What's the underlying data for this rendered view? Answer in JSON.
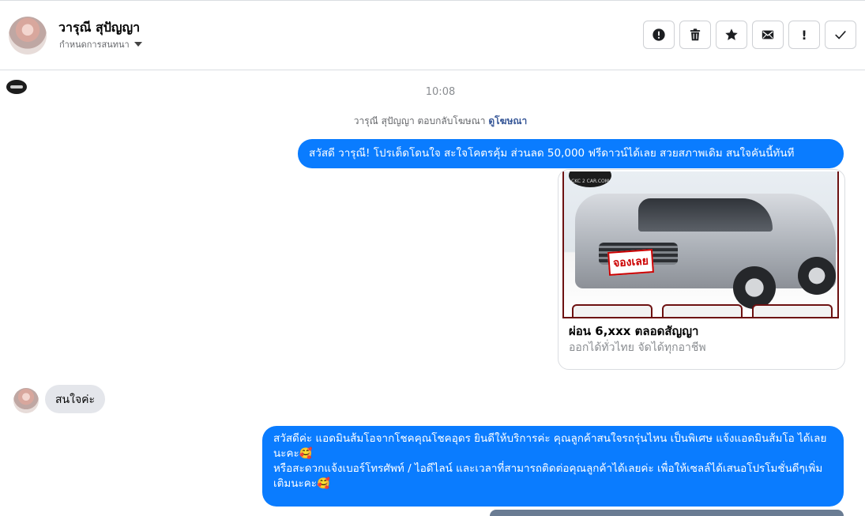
{
  "header": {
    "contact_name": "วารุณี สุปัญญา",
    "subtitle": "กำหนดการสนทนา",
    "actions": [
      {
        "name": "report-button",
        "icon": "alert-circle-icon"
      },
      {
        "name": "delete-button",
        "icon": "trash-icon"
      },
      {
        "name": "star-button",
        "icon": "star-icon"
      },
      {
        "name": "mark-unread-button",
        "icon": "envelope-icon"
      },
      {
        "name": "flag-button",
        "icon": "exclamation-icon",
        "glyph": "!"
      },
      {
        "name": "done-button",
        "icon": "checkmark-icon"
      }
    ]
  },
  "conversation": {
    "timestamp": "10:08",
    "ad_reply_text": "วารุณี สุปัญญา ตอบกลับโฆษณา",
    "ad_reply_link": "ดูโฆษณา",
    "messages": [
      {
        "direction": "out",
        "text": "สวัสดี วารุณี! โปรเด็ดโดนใจ สะใจโคตรคุ้ม ส่วนลด 50,000 ฟรีดาวน์ได้เลย สวยสภาพเดิม สนใจคันนี้ทันที"
      },
      {
        "direction": "in",
        "text": "สนใจค่ะ"
      },
      {
        "direction": "out",
        "text": "สวัสดีค่ะ แอดมินส้มโอจากโชคคุณโชคอุดร ยินดีให้บริการค่ะ   คุณลูกค้าสนใจรถรุ่นไหน เป็นพิเศษ แจ้งแอดมินส้มโอ ได้เลยนะคะ🥰\nหรือสะดวกแจ้งเบอร์โทรศัพท์ / ไอดีไลน์ และเวลาที่สามารถติดต่อคุณลูกค้าได้เลยค่ะ เพื่อให้เซลล์ได้เสนอโปรโมชั่นดีๆเพิ่มเติมนะคะ🥰"
      }
    ],
    "ad_card": {
      "title": "ผ่อน 6,xxx ตลอดสัญญา",
      "subtitle": "ออกได้ทั่วไทย จัดได้ทุกอาชีพ",
      "image_stamp": "จองเลย",
      "logo_text": "CKC 2 CAR.COM"
    }
  },
  "colors": {
    "outgoing_bubble": "#0a7cff",
    "incoming_bubble": "#e4e6eb",
    "link": "#385898"
  }
}
